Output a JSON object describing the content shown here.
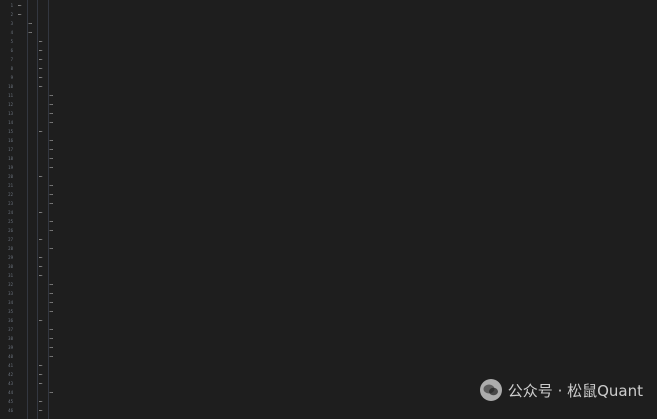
{
  "editor": {
    "theme": {
      "background": "#1e1e1e",
      "line_number": "#6e7681",
      "text": "#d4d4d4"
    },
    "code_legible": false,
    "line_count": 46
  },
  "watermark": {
    "text": "公众号 · 松鼠Quant",
    "icon": "wechat-official-account-icon"
  }
}
